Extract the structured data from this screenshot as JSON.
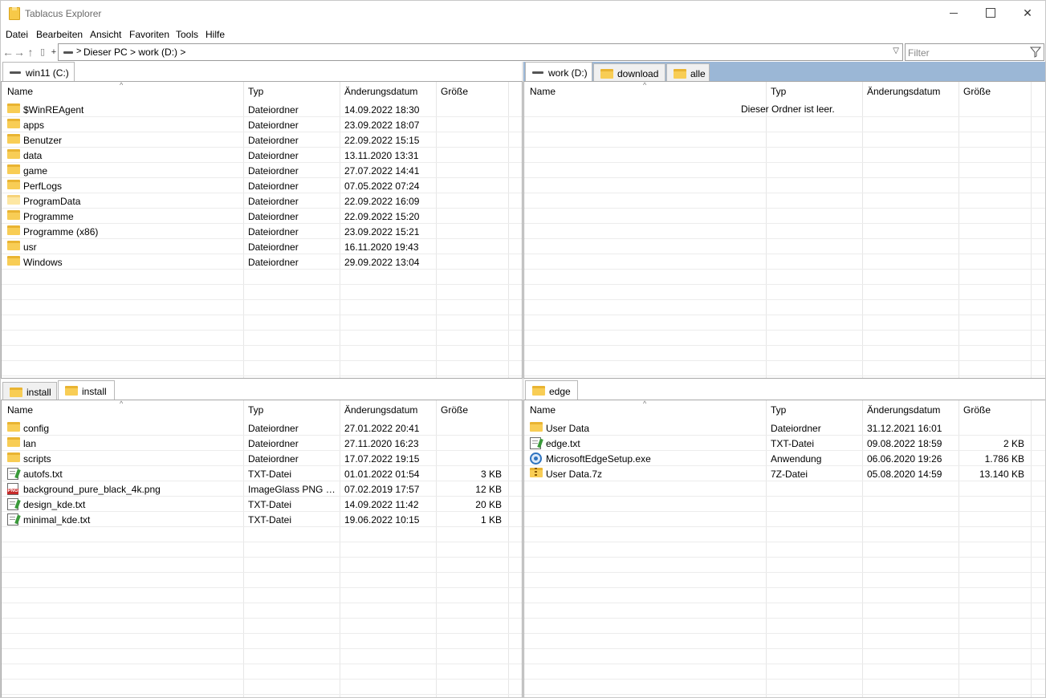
{
  "app": {
    "title": "Tablacus Explorer"
  },
  "menu": [
    "Datei",
    "Bearbeiten",
    "Ansicht",
    "Favoriten",
    "Tools",
    "Hilfe"
  ],
  "nav": {
    "address_path": "Dieser PC > work (D:) >",
    "filter_placeholder": "Filter"
  },
  "columns": {
    "name": "Name",
    "type": "Typ",
    "date": "Änderungsdatum",
    "size": "Größe"
  },
  "panes": {
    "top_left": {
      "tabs": [
        {
          "label": "win11 (C:)",
          "icon": "drive-icon",
          "active": true
        }
      ],
      "rows": [
        {
          "name": "$WinREAgent",
          "type": "Dateiordner",
          "date": "14.09.2022 18:30",
          "size": "",
          "icon": "folder-icon"
        },
        {
          "name": "apps",
          "type": "Dateiordner",
          "date": "23.09.2022 18:07",
          "size": "",
          "icon": "folder-icon"
        },
        {
          "name": "Benutzer",
          "type": "Dateiordner",
          "date": "22.09.2022 15:15",
          "size": "",
          "icon": "folder-icon"
        },
        {
          "name": "data",
          "type": "Dateiordner",
          "date": "13.11.2020 13:31",
          "size": "",
          "icon": "folder-icon"
        },
        {
          "name": "game",
          "type": "Dateiordner",
          "date": "27.07.2022 14:41",
          "size": "",
          "icon": "folder-icon"
        },
        {
          "name": "PerfLogs",
          "type": "Dateiordner",
          "date": "07.05.2022 07:24",
          "size": "",
          "icon": "folder-icon"
        },
        {
          "name": "ProgramData",
          "type": "Dateiordner",
          "date": "22.09.2022 16:09",
          "size": "",
          "icon": "folder-hidden-icon"
        },
        {
          "name": "Programme",
          "type": "Dateiordner",
          "date": "22.09.2022 15:20",
          "size": "",
          "icon": "folder-icon"
        },
        {
          "name": "Programme (x86)",
          "type": "Dateiordner",
          "date": "23.09.2022 15:21",
          "size": "",
          "icon": "folder-icon"
        },
        {
          "name": "usr",
          "type": "Dateiordner",
          "date": "16.11.2020 19:43",
          "size": "",
          "icon": "folder-icon"
        },
        {
          "name": "Windows",
          "type": "Dateiordner",
          "date": "29.09.2022 13:04",
          "size": "",
          "icon": "folder-icon"
        }
      ]
    },
    "top_right": {
      "tabs": [
        {
          "label": "work (D:)",
          "icon": "drive-icon",
          "active": true
        },
        {
          "label": "download",
          "icon": "folder-icon",
          "active": false
        },
        {
          "label": "alle",
          "icon": "folder-icon",
          "active": false
        }
      ],
      "empty_message": "Dieser Ordner ist leer.",
      "rows": []
    },
    "bottom_left": {
      "tabs": [
        {
          "label": "install",
          "icon": "folder-icon",
          "active": false
        },
        {
          "label": "install",
          "icon": "folder-icon",
          "active": true
        }
      ],
      "rows": [
        {
          "name": "config",
          "type": "Dateiordner",
          "date": "27.01.2022 20:41",
          "size": "",
          "icon": "folder-icon"
        },
        {
          "name": "lan",
          "type": "Dateiordner",
          "date": "27.11.2020 16:23",
          "size": "",
          "icon": "folder-icon"
        },
        {
          "name": "scripts",
          "type": "Dateiordner",
          "date": "17.07.2022 19:15",
          "size": "",
          "icon": "folder-icon"
        },
        {
          "name": "autofs.txt",
          "type": "TXT-Datei",
          "date": "01.01.2022 01:54",
          "size": "3 KB",
          "icon": "text-file-icon"
        },
        {
          "name": "background_pure_black_4k.png",
          "type": "ImageGlass PNG F...",
          "date": "07.02.2019 17:57",
          "size": "12 KB",
          "icon": "png-file-icon"
        },
        {
          "name": "design_kde.txt",
          "type": "TXT-Datei",
          "date": "14.09.2022 11:42",
          "size": "20 KB",
          "icon": "text-file-icon"
        },
        {
          "name": "minimal_kde.txt",
          "type": "TXT-Datei",
          "date": "19.06.2022 10:15",
          "size": "1 KB",
          "icon": "text-file-icon"
        }
      ]
    },
    "bottom_right": {
      "tabs": [
        {
          "label": "edge",
          "icon": "folder-icon",
          "active": true
        }
      ],
      "rows": [
        {
          "name": "User Data",
          "type": "Dateiordner",
          "date": "31.12.2021 16:01",
          "size": "",
          "icon": "folder-icon"
        },
        {
          "name": "edge.txt",
          "type": "TXT-Datei",
          "date": "09.08.2022 18:59",
          "size": "2 KB",
          "icon": "text-file-icon"
        },
        {
          "name": "MicrosoftEdgeSetup.exe",
          "type": "Anwendung",
          "date": "06.06.2020 19:26",
          "size": "1.786 KB",
          "icon": "exe-file-icon"
        },
        {
          "name": "User Data.7z",
          "type": "7Z-Datei",
          "date": "05.08.2020 14:59",
          "size": "13.140 KB",
          "icon": "archive-icon"
        }
      ]
    }
  }
}
